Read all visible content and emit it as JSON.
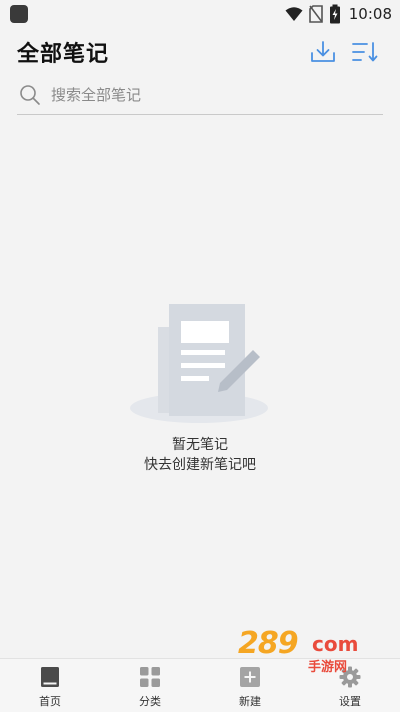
{
  "status_bar": {
    "time": "10:08"
  },
  "header": {
    "title": "全部笔记"
  },
  "search": {
    "placeholder": "搜索全部笔记"
  },
  "empty_state": {
    "title": "暂无笔记",
    "subtitle": "快去创建新笔记吧"
  },
  "bottom_nav": {
    "items": [
      {
        "label": "首页",
        "icon": "book-icon"
      },
      {
        "label": "分类",
        "icon": "grid-icon"
      },
      {
        "label": "新建",
        "icon": "add-icon"
      },
      {
        "label": "设置",
        "icon": "gear-icon"
      }
    ]
  },
  "watermark": {
    "number": "289",
    "domain": "com",
    "text": "手游网"
  },
  "colors": {
    "accent": "#4a90e2",
    "background": "#f3f3f3",
    "watermark_orange": "#f5a623",
    "watermark_red": "#e94b3c"
  }
}
